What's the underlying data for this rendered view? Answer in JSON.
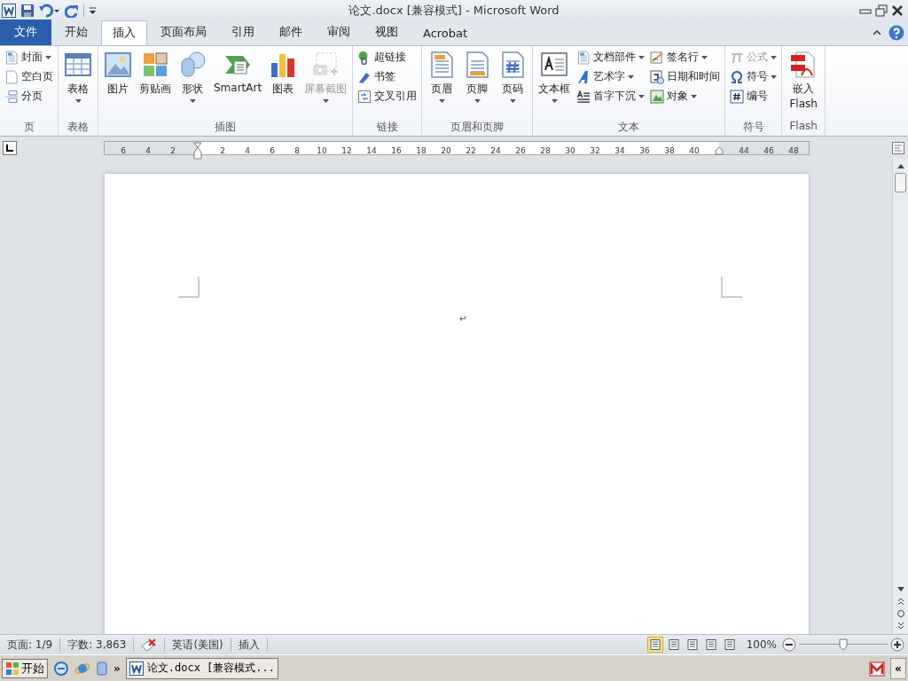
{
  "window": {
    "title": "论文.docx [兼容模式]  -  Microsoft Word"
  },
  "tabs": [
    {
      "label": "文件",
      "kind": "file",
      "selected": false
    },
    {
      "label": "开始",
      "kind": "tab",
      "selected": false
    },
    {
      "label": "插入",
      "kind": "tab",
      "selected": true
    },
    {
      "label": "页面布局",
      "kind": "tab",
      "selected": false
    },
    {
      "label": "引用",
      "kind": "tab",
      "selected": false
    },
    {
      "label": "邮件",
      "kind": "tab",
      "selected": false
    },
    {
      "label": "审阅",
      "kind": "tab",
      "selected": false
    },
    {
      "label": "视图",
      "kind": "tab",
      "selected": false
    },
    {
      "label": "Acrobat",
      "kind": "tab",
      "selected": false
    }
  ],
  "ribbon_groups": [
    {
      "name": "页",
      "items": [
        {
          "label": "封面",
          "kind": "small",
          "dropdown": true,
          "disabled": false
        },
        {
          "label": "空白页",
          "kind": "small",
          "dropdown": false,
          "disabled": false
        },
        {
          "label": "分页",
          "kind": "small",
          "dropdown": false,
          "disabled": false
        }
      ]
    },
    {
      "name": "表格",
      "items": [
        {
          "label": "表格",
          "kind": "large",
          "dropdown": true,
          "disabled": false
        }
      ]
    },
    {
      "name": "插图",
      "items": [
        {
          "label": "图片",
          "kind": "large",
          "dropdown": false,
          "disabled": false
        },
        {
          "label": "剪贴画",
          "kind": "large",
          "dropdown": false,
          "disabled": false
        },
        {
          "label": "形状",
          "kind": "large",
          "dropdown": true,
          "disabled": false
        },
        {
          "label": "SmartArt",
          "kind": "large",
          "dropdown": false,
          "disabled": false
        },
        {
          "label": "图表",
          "kind": "large",
          "dropdown": false,
          "disabled": false
        },
        {
          "label": "屏幕截图",
          "kind": "large",
          "dropdown": true,
          "disabled": true
        }
      ]
    },
    {
      "name": "链接",
      "items": [
        {
          "label": "超链接",
          "kind": "small",
          "dropdown": false,
          "disabled": false
        },
        {
          "label": "书签",
          "kind": "small",
          "dropdown": false,
          "disabled": false
        },
        {
          "label": "交叉引用",
          "kind": "small",
          "dropdown": false,
          "disabled": false
        }
      ]
    },
    {
      "name": "页眉和页脚",
      "items": [
        {
          "label": "页眉",
          "kind": "large",
          "dropdown": true,
          "disabled": false
        },
        {
          "label": "页脚",
          "kind": "large",
          "dropdown": true,
          "disabled": false
        },
        {
          "label": "页码",
          "kind": "large",
          "dropdown": true,
          "disabled": false
        }
      ]
    },
    {
      "name": "文本",
      "items": [
        {
          "label": "文本框",
          "kind": "large",
          "dropdown": true,
          "disabled": false
        },
        {
          "label": "文档部件",
          "kind": "small",
          "dropdown": true,
          "disabled": false
        },
        {
          "label": "艺术字",
          "kind": "small",
          "dropdown": true,
          "disabled": false
        },
        {
          "label": "首字下沉",
          "kind": "small",
          "dropdown": true,
          "disabled": false
        },
        {
          "label": "签名行",
          "kind": "small",
          "dropdown": true,
          "disabled": false
        },
        {
          "label": "日期和时间",
          "kind": "small",
          "dropdown": false,
          "disabled": false
        },
        {
          "label": "对象",
          "kind": "small",
          "dropdown": true,
          "disabled": false
        }
      ]
    },
    {
      "name": "符号",
      "items": [
        {
          "label": "公式",
          "kind": "small",
          "dropdown": true,
          "disabled": true
        },
        {
          "label": "符号",
          "kind": "small",
          "dropdown": true,
          "disabled": false
        },
        {
          "label": "编号",
          "kind": "small",
          "dropdown": false,
          "disabled": false
        }
      ]
    },
    {
      "name": "Flash",
      "items": [
        {
          "label": "嵌入 Flash",
          "kind": "large",
          "dropdown": false,
          "disabled": false
        }
      ]
    }
  ],
  "ruler": {
    "left_labels": [
      "6",
      "4",
      "2"
    ],
    "labels": [
      "2",
      "4",
      "6",
      "8",
      "10",
      "12",
      "14",
      "16",
      "18",
      "20",
      "22",
      "24",
      "26",
      "28",
      "30",
      "32",
      "34",
      "36",
      "38",
      "40"
    ],
    "right_labels": [
      "44",
      "46",
      "48"
    ]
  },
  "document": {
    "paragraph_mark": "↵"
  },
  "status_bar": {
    "page": "页面: 1/9",
    "words": "字数: 3,863",
    "language": "英语(美国)",
    "mode": "插入",
    "views": [
      {
        "selected": true
      },
      {
        "selected": false
      },
      {
        "selected": false
      },
      {
        "selected": false
      },
      {
        "selected": false
      }
    ],
    "zoom": "100%",
    "zoom_level": {
      "level": 0.5
    }
  },
  "taskbar": {
    "start": "开始",
    "more": "»",
    "tasks": [
      {
        "label": "论文.docx [兼容模式...",
        "selected": false
      }
    ],
    "collapse": "«"
  }
}
